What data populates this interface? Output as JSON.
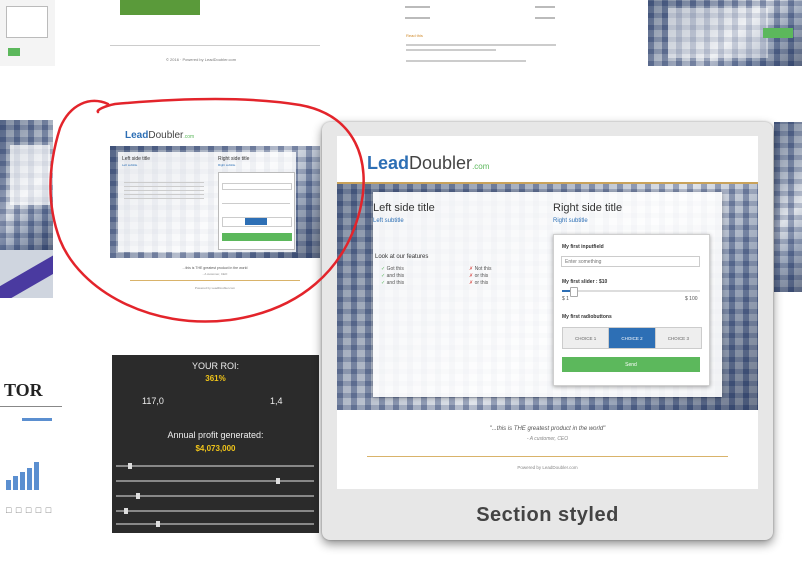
{
  "thumbs": {
    "top_center_footer": "© 2016 · Powered by LeadDoubler.com",
    "top_right_doc_title": "Read this",
    "roi": {
      "title": "YOUR ROI:",
      "percent": "361%",
      "left_value": "117,0",
      "right_value": "1,4",
      "profit_label": "Annual profit generated:",
      "profit_value": "$4,073,000"
    },
    "calculator_title": "TOR",
    "calculator_dots": "□ □ □ □ □"
  },
  "small_preview": {
    "logo_lead": "Lead",
    "logo_doubler": "Doubler",
    "logo_com": ".com",
    "left_title": "Left side title",
    "left_subtitle": "Left subtitle",
    "right_title": "Right side title",
    "right_subtitle": "Right subtitle",
    "quote": "...this is THE greatest product in the world",
    "author": "- A customer, CEO",
    "footer": "Powered by LeadDoubler.com"
  },
  "main": {
    "logo_lead": "Lead",
    "logo_doubler": "Doubler",
    "logo_com": ".com",
    "left_title": "Left side title",
    "left_subtitle": "Left subtitle",
    "features_label": "Look at our features",
    "features_check": [
      "Got this",
      "and this",
      "and this"
    ],
    "features_cross": [
      "Not this",
      "or this",
      "or this"
    ],
    "right_title": "Right side title",
    "right_subtitle": "Right subtitle",
    "input_label": "My first inputfield",
    "input_placeholder": "Enter something",
    "slider_label": "My first slider : $10",
    "slider_min": "$ 1",
    "slider_max": "$ 100",
    "slider_value": 0.08,
    "radio_label": "My first radiobuttons",
    "choices": [
      "CHOICE 1",
      "CHOICE 2",
      "CHOICE 3"
    ],
    "selected_choice": 1,
    "send": "Send",
    "quote": "\"...this is THE greatest product in the world\"",
    "author": "- A customer, CEO",
    "footer": "Powered by LeadDoubler.com",
    "section_label": "Section styled"
  },
  "colors": {
    "accent_blue": "#2d6fb5",
    "accent_green": "#5cb85c",
    "annotation_red": "#e3242b",
    "roi_bg": "#2b2b2b",
    "roi_yellow": "#f0c419"
  }
}
